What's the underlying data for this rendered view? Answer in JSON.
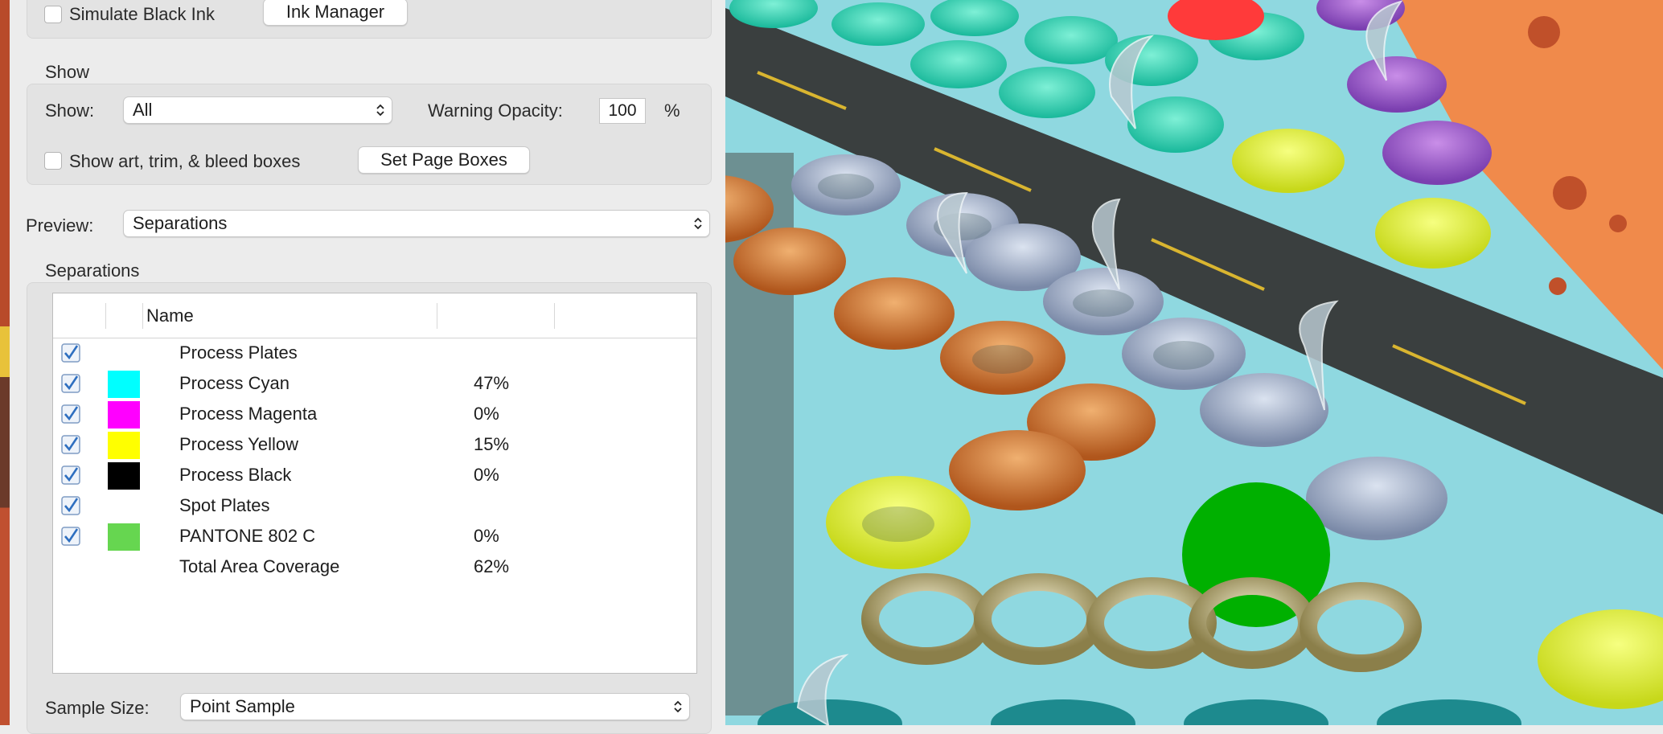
{
  "ink": {
    "simulate_black_ink_label": "Simulate Black Ink",
    "ink_manager_label": "Ink Manager"
  },
  "show_section": {
    "title": "Show",
    "show_label": "Show:",
    "show_value": "All",
    "warning_opacity_label": "Warning Opacity:",
    "warning_opacity_value": "100",
    "percent_sign": "%",
    "show_boxes_label": "Show art, trim, & bleed boxes",
    "set_page_boxes_label": "Set Page Boxes"
  },
  "preview": {
    "label": "Preview:",
    "value": "Separations"
  },
  "separations": {
    "title": "Separations",
    "column_name": "Name",
    "rows": [
      {
        "name": "Process Plates",
        "pct": "",
        "checked": true,
        "swatch": ""
      },
      {
        "name": "Process Cyan",
        "pct": "47%",
        "checked": true,
        "swatch": "#00ffff"
      },
      {
        "name": "Process Magenta",
        "pct": "0%",
        "checked": true,
        "swatch": "#ff00ff"
      },
      {
        "name": "Process Yellow",
        "pct": "15%",
        "checked": true,
        "swatch": "#ffff00"
      },
      {
        "name": "Process Black",
        "pct": "0%",
        "checked": true,
        "swatch": "#000000"
      },
      {
        "name": "Spot Plates",
        "pct": "",
        "checked": true,
        "swatch": ""
      },
      {
        "name": "PANTONE 802 C",
        "pct": "0%",
        "checked": true,
        "swatch": "#66d650"
      },
      {
        "name": "Total Area Coverage",
        "pct": "62%",
        "checked": false,
        "swatch": ""
      }
    ]
  },
  "sample": {
    "label": "Sample Size:",
    "value": "Point Sample"
  },
  "colors": {
    "accent_check": "#3b78c6",
    "scene_floor": "#8fd8e0",
    "scene_road": "#3a3f3f",
    "scene_orange": "#f08a4b"
  }
}
